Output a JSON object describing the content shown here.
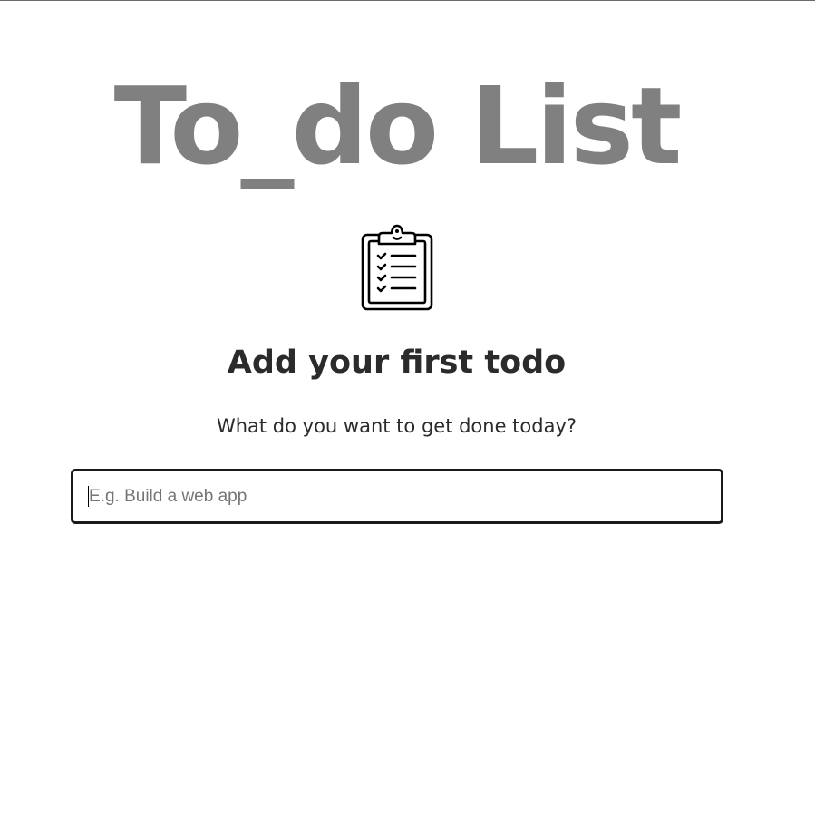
{
  "app": {
    "title": "To_do List"
  },
  "empty_state": {
    "icon": "clipboard-checklist-icon",
    "heading": "Add your first todo",
    "subheading": "What do you want to get done today?"
  },
  "todo_input": {
    "value": "",
    "placeholder": "E.g. Build a web app"
  }
}
